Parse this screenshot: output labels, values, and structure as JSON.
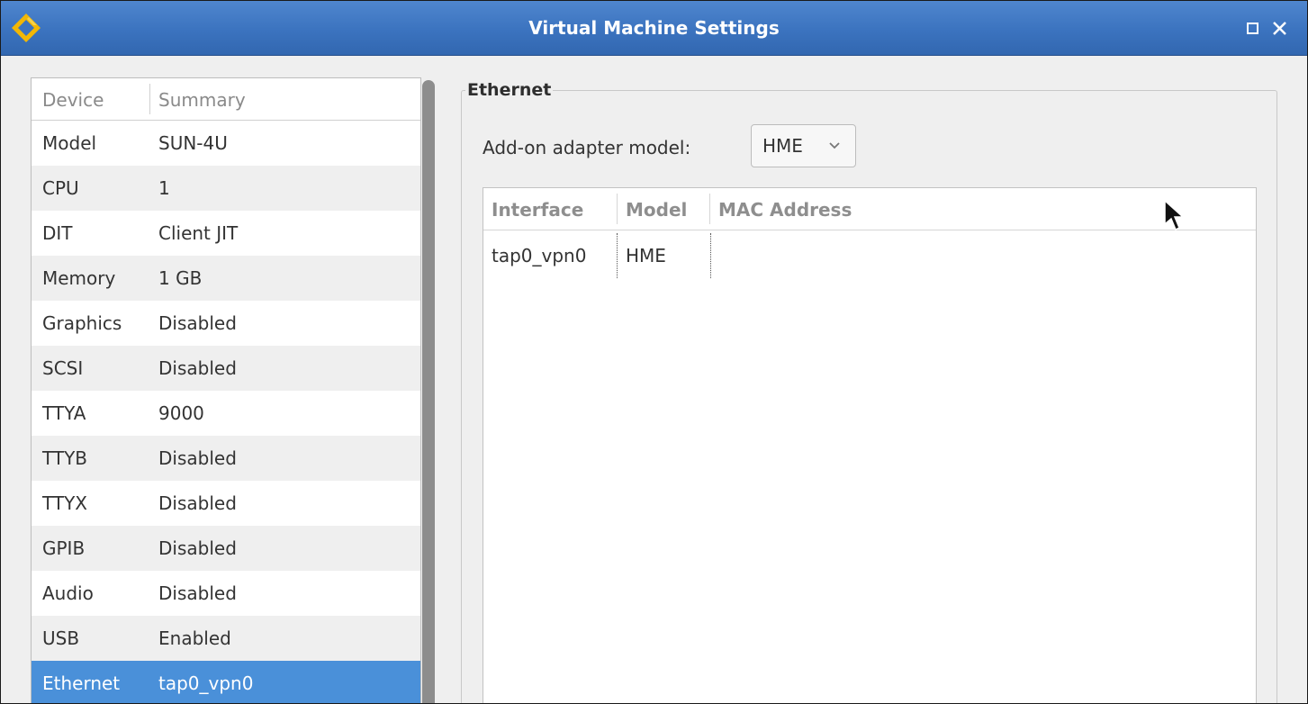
{
  "window": {
    "title": "Virtual Machine Settings",
    "maximize_icon": "maximize-icon",
    "close_icon": "close-icon",
    "titlebar_color": "#3b73bf",
    "accent_color": "#4a90d9"
  },
  "device_list": {
    "headers": {
      "device": "Device",
      "summary": "Summary"
    },
    "rows": [
      {
        "device": "Model",
        "summary": "SUN-4U"
      },
      {
        "device": "CPU",
        "summary": "1"
      },
      {
        "device": "DIT",
        "summary": "Client JIT"
      },
      {
        "device": "Memory",
        "summary": "1 GB"
      },
      {
        "device": "Graphics",
        "summary": "Disabled"
      },
      {
        "device": "SCSI",
        "summary": "Disabled"
      },
      {
        "device": "TTYA",
        "summary": "9000"
      },
      {
        "device": "TTYB",
        "summary": "Disabled"
      },
      {
        "device": "TTYX",
        "summary": "Disabled"
      },
      {
        "device": "GPIB",
        "summary": "Disabled"
      },
      {
        "device": "Audio",
        "summary": "Disabled"
      },
      {
        "device": "USB",
        "summary": "Enabled"
      },
      {
        "device": "Ethernet",
        "summary": "tap0_vpn0"
      }
    ],
    "selected_device": "Ethernet"
  },
  "ethernet": {
    "group_title": "Ethernet",
    "adapter_label": "Add-on adapter model:",
    "adapter_value": "HME",
    "table": {
      "headers": {
        "interface": "Interface",
        "model": "Model",
        "mac": "MAC Address"
      },
      "rows": [
        {
          "interface": "tap0_vpn0",
          "model": "HME",
          "mac": ""
        }
      ]
    }
  }
}
